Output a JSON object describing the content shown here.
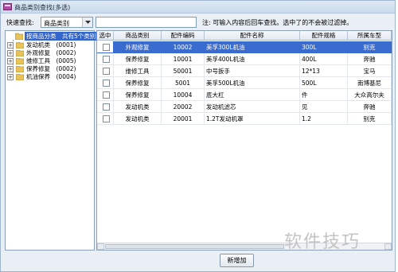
{
  "window": {
    "title": "商品类别查找(多选)"
  },
  "search": {
    "label": "快速查找:",
    "category_value": "商品类别",
    "input_value": "",
    "hint": "注: 可输入内容后回车查找。选中了的不会被过滤掉。"
  },
  "tree": {
    "root_label": "按商品分类　共有5个类别",
    "items": [
      {
        "label": "发动机类　(0001)"
      },
      {
        "label": "外观修复　(0002)"
      },
      {
        "label": "维修工具　(0005)"
      },
      {
        "label": "保养修复　(0002)"
      },
      {
        "label": "机油保养　(0004)"
      }
    ]
  },
  "grid": {
    "columns": [
      "选中",
      "商品类别",
      "配件编码",
      "配件名称",
      "配件规格",
      "所属车型"
    ],
    "rows": [
      {
        "category": "外观修复",
        "code": "10002",
        "name": "美孚300L机油",
        "spec": "300L",
        "model": "别克",
        "selected": true
      },
      {
        "category": "保养修复",
        "code": "10001",
        "name": "美孚400L机油",
        "spec": "400L",
        "model": "奔驰",
        "selected": false
      },
      {
        "category": "维修工具",
        "code": "50001",
        "name": "中号扳手",
        "spec": "12*13",
        "model": "宝马",
        "selected": false
      },
      {
        "category": "保养修复",
        "code": "5001",
        "name": "美孚500L机油",
        "spec": "500L",
        "model": "南博基尼",
        "selected": false
      },
      {
        "category": "保养修复",
        "code": "10004",
        "name": "底大杠",
        "spec": "件",
        "model": "大众高尔夫",
        "selected": false
      },
      {
        "category": "发动机类",
        "code": "20002",
        "name": "发动机滤芯",
        "spec": "见",
        "model": "奔驰",
        "selected": false
      },
      {
        "category": "发动机类",
        "code": "20001",
        "name": "1.2T发动机罩",
        "spec": "1.2",
        "model": "别克",
        "selected": false
      }
    ]
  },
  "buttons": {
    "add_label": "新增加"
  },
  "watermark": "软件技巧",
  "colors": {
    "selection": "#3a6ccf",
    "tree_highlight": "#3366cc"
  }
}
